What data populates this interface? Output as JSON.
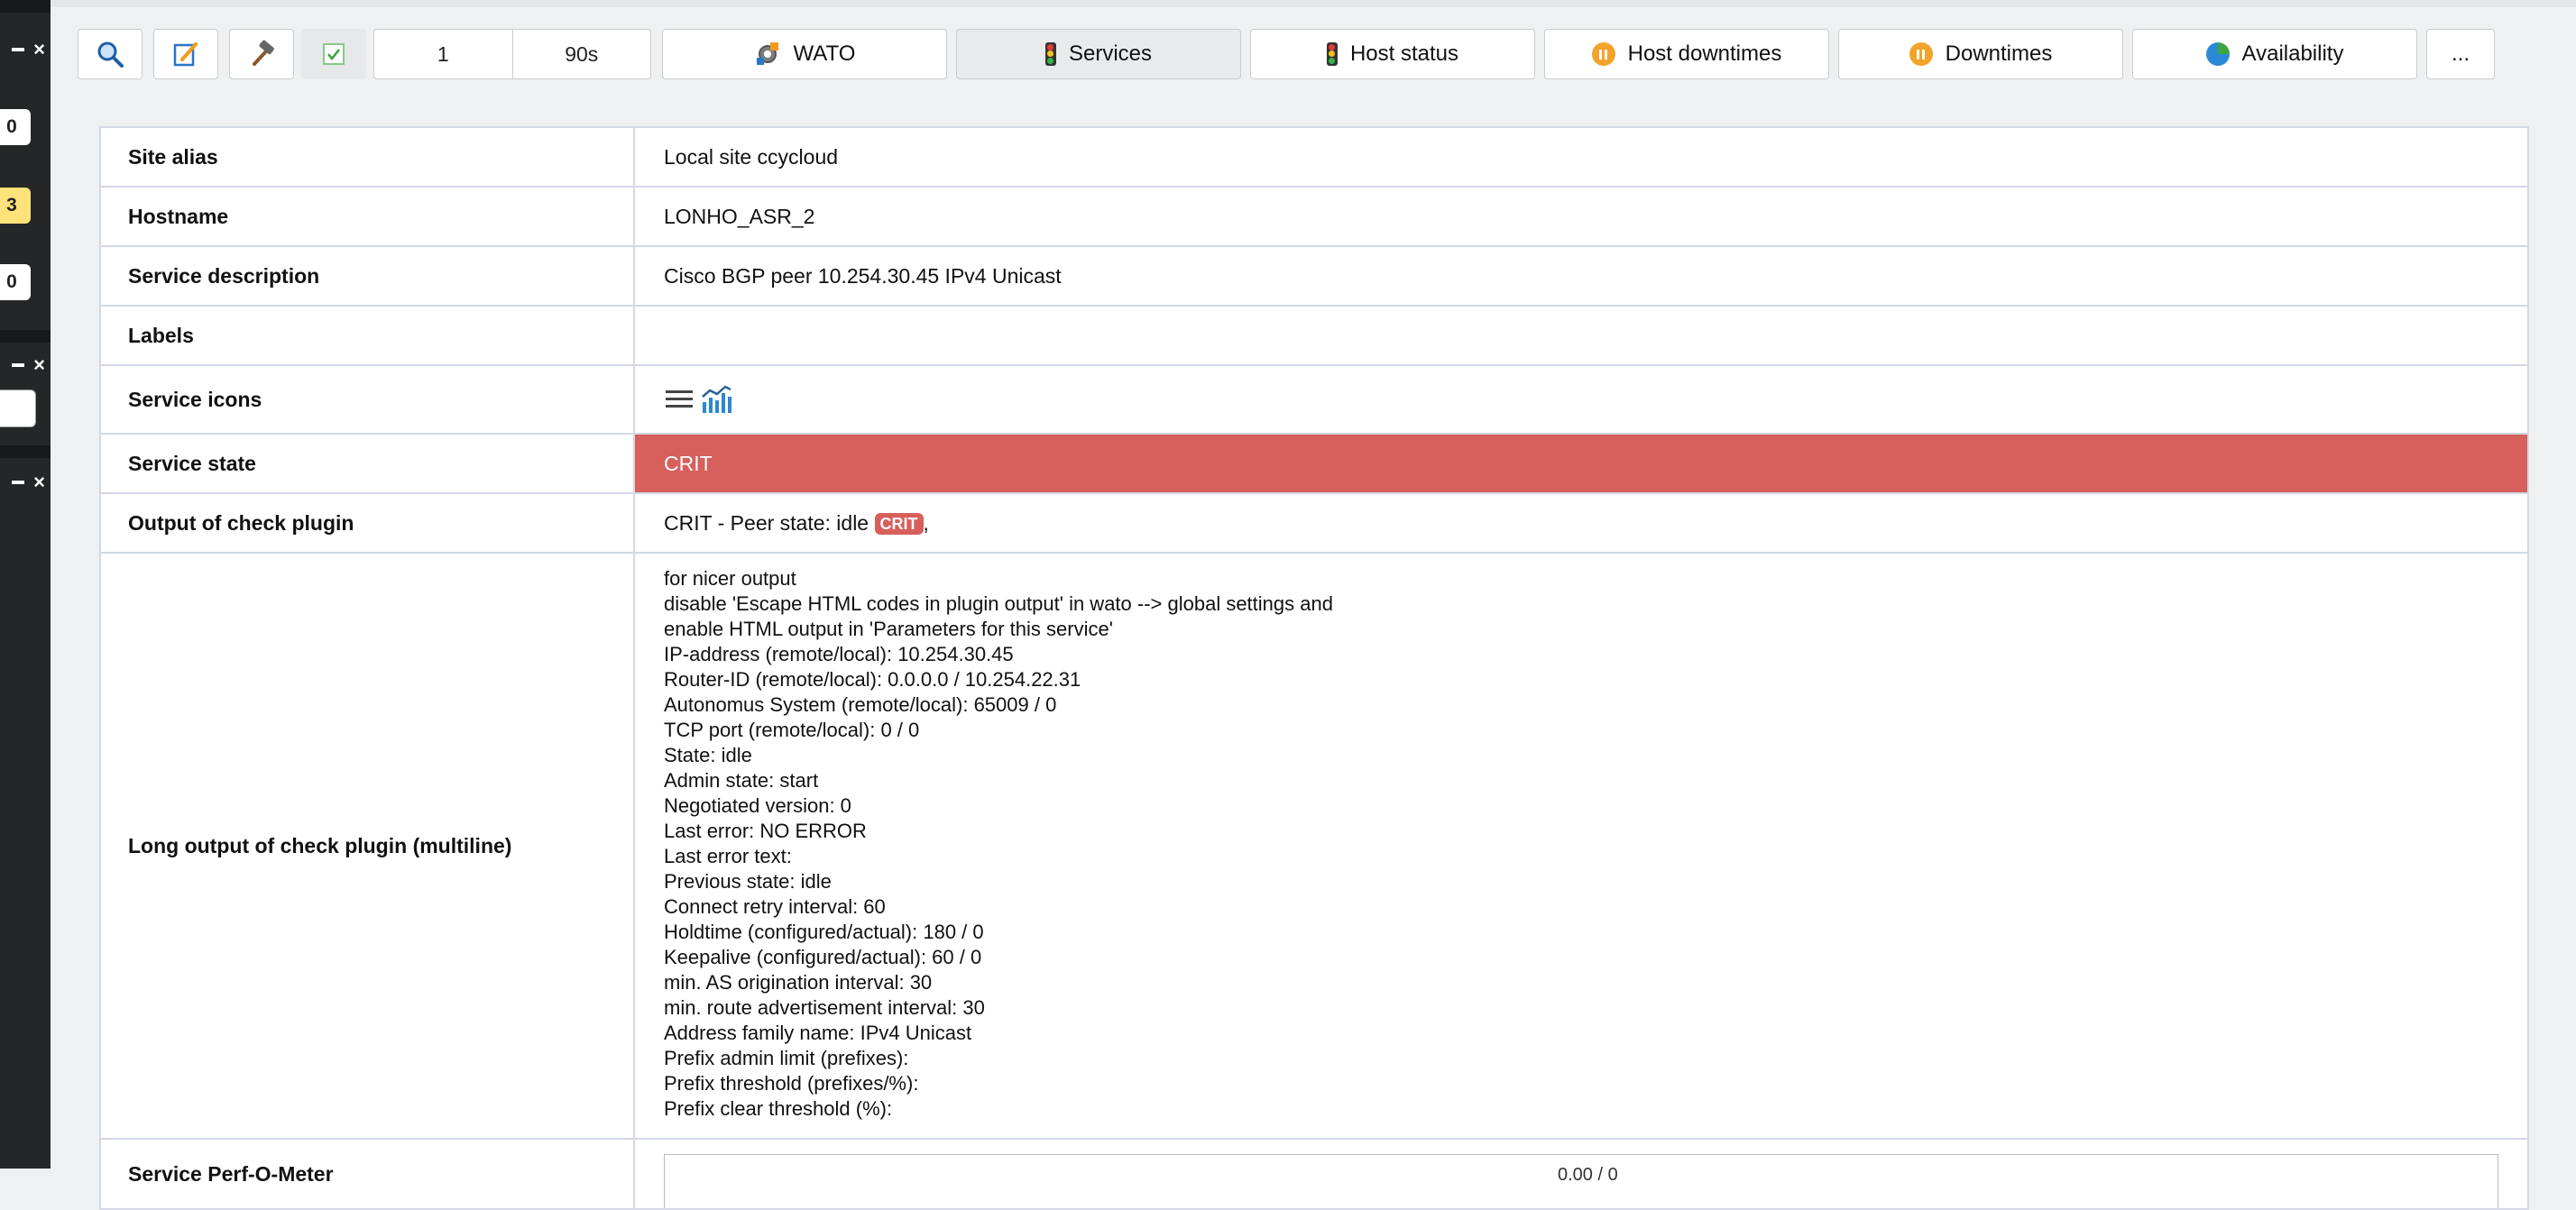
{
  "sidebar": {
    "badges": [
      "0",
      "3",
      "0"
    ]
  },
  "toolbar": {
    "refresh_count": "1",
    "refresh_interval": "90s",
    "buttons": [
      {
        "label": "WATO",
        "icon": "wato-icon"
      },
      {
        "label": "Services",
        "icon": "traffic-light-icon"
      },
      {
        "label": "Host status",
        "icon": "traffic-light-icon"
      },
      {
        "label": "Host downtimes",
        "icon": "downtime-icon"
      },
      {
        "label": "Downtimes",
        "icon": "downtime-icon"
      },
      {
        "label": "Availability",
        "icon": "availability-icon"
      }
    ],
    "more_label": "..."
  },
  "table": {
    "site_alias": {
      "label": "Site alias",
      "value": "Local site ccycloud"
    },
    "hostname": {
      "label": "Hostname",
      "value": "LONHO_ASR_2"
    },
    "service_description": {
      "label": "Service description",
      "value": "Cisco BGP peer 10.254.30.45 IPv4 Unicast"
    },
    "labels": {
      "label": "Labels",
      "value": ""
    },
    "service_icons": {
      "label": "Service icons"
    },
    "service_state": {
      "label": "Service state",
      "value": "CRIT"
    },
    "output": {
      "label": "Output of check plugin",
      "value": "CRIT - Peer state: idle",
      "pill": "CRIT",
      "suffix": ","
    },
    "long_output": {
      "label": "Long output of check plugin (multiline)",
      "lines": [
        "for nicer output",
        "disable 'Escape HTML codes in plugin output' in wato --> global settings and",
        "enable HTML output in 'Parameters for this service'",
        "IP-address (remote/local): 10.254.30.45",
        "Router-ID (remote/local): 0.0.0.0 / 10.254.22.31",
        "Autonomus System (remote/local): 65009 / 0",
        "TCP port (remote/local): 0 / 0",
        "State: idle",
        "Admin state: start",
        "Negotiated version: 0",
        "Last error: NO ERROR",
        "Last error text:",
        "Previous state: idle",
        "Connect retry interval: 60",
        "Holdtime (configured/actual): 180 / 0",
        "Keepalive (configured/actual): 60 / 0",
        "min. AS origination interval: 30",
        "min. route advertisement interval: 30",
        "Address family name: IPv4 Unicast",
        "Prefix admin limit (prefixes):",
        "Prefix threshold (prefixes/%):",
        "Prefix clear threshold (%):"
      ]
    },
    "perf": {
      "label": "Service Perf-O-Meter",
      "value": "0.00 / 0"
    }
  },
  "colors": {
    "crit": "#d75f5c",
    "warn_badge": "#ffe27a",
    "sidebar": "#242627"
  }
}
